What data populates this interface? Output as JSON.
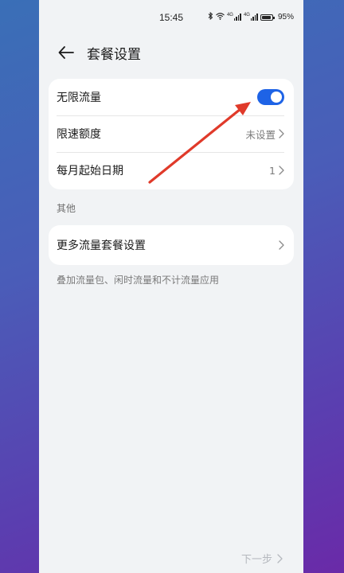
{
  "status_bar": {
    "time": "15:45",
    "battery": "95%",
    "network_1": "4G",
    "network_2": "4G"
  },
  "header": {
    "title": "套餐设置"
  },
  "plan_card": {
    "unlimited_label": "无限流量",
    "unlimited_on": true,
    "speed_limit_label": "限速额度",
    "speed_limit_value": "未设置",
    "start_date_label": "每月起始日期",
    "start_date_value": "1"
  },
  "section_other": {
    "title": "其他"
  },
  "more_card": {
    "more_label": "更多流量套餐设置"
  },
  "footnote": "叠加流量包、闲时流量和不计流量应用",
  "footer": {
    "next_label": "下一步"
  },
  "colors": {
    "accent": "#1e63e6",
    "annotation_arrow": "#e03a2a",
    "page_bg": "#f1f3f5"
  },
  "icons": [
    "bluetooth-icon",
    "wifi-icon",
    "signal-icon",
    "battery-icon",
    "back-arrow-icon",
    "chevron-right-icon",
    "annotation-arrow"
  ]
}
